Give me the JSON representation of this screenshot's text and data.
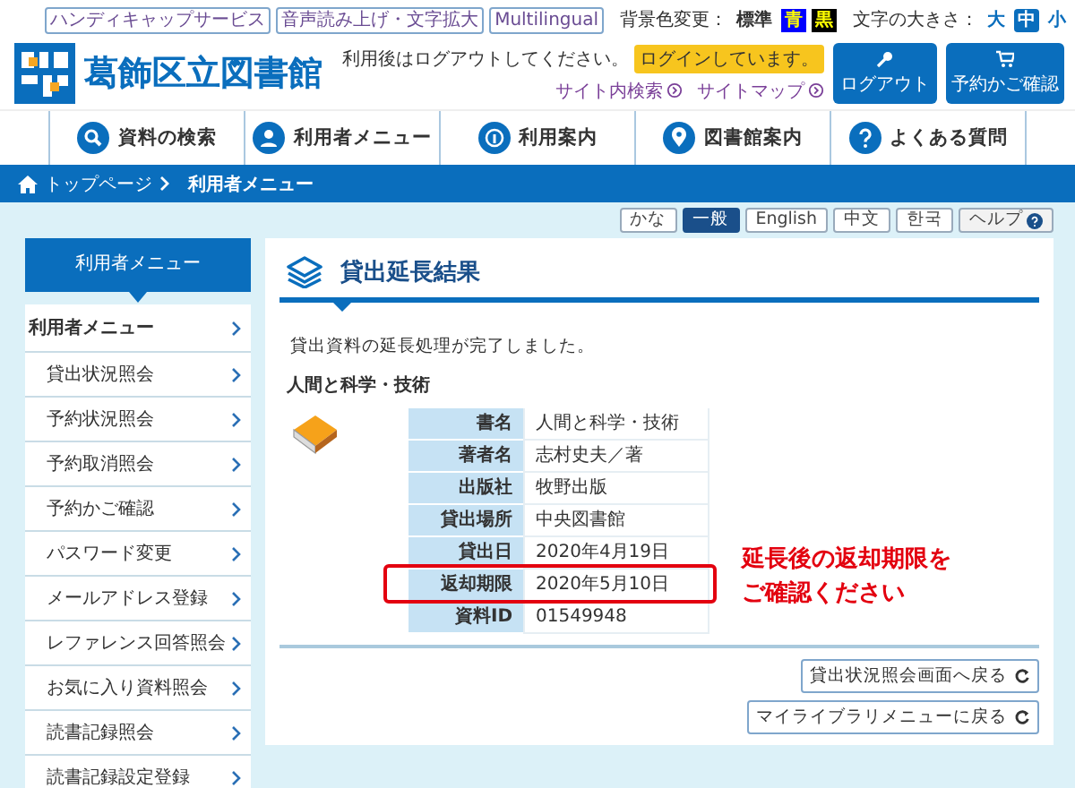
{
  "header": {
    "logo_title": "葛飾区立図書館",
    "links": [
      "ハンディキャップサービス",
      "音声読み上げ・文字拡大",
      "Multilingual"
    ],
    "bg_color": {
      "label": "背景色変更：",
      "options": [
        {
          "label": "標準",
          "color": "#ffffff"
        },
        {
          "label": "青",
          "color": "#0000ff"
        },
        {
          "label": "黒",
          "color": "#000000"
        }
      ]
    },
    "font_size": {
      "label": "文字の大きさ：",
      "options": [
        {
          "label": "大",
          "selected": false
        },
        {
          "label": "中",
          "selected": true
        },
        {
          "label": "小",
          "selected": false
        }
      ]
    },
    "logout_note": "利用後はログアウトしてください。",
    "login_status": "ログインしています。",
    "site_links": [
      "サイト内検索",
      "サイトマップ"
    ],
    "buttons": [
      {
        "label": "ログアウト",
        "kind": "key"
      },
      {
        "label": "予約かご確認",
        "kind": "cart"
      }
    ]
  },
  "nav": [
    {
      "label": "資料の検索",
      "kind": "search"
    },
    {
      "label": "利用者メニュー",
      "kind": "person"
    },
    {
      "label": "利用案内",
      "kind": "info"
    },
    {
      "label": "図書館案内",
      "kind": "pin"
    },
    {
      "label": "よくある質問",
      "kind": "question"
    }
  ],
  "breadcrumb": [
    "トップページ",
    "利用者メニュー"
  ],
  "languages": [
    {
      "label": "かな",
      "selected": false
    },
    {
      "label": "一般",
      "selected": true
    },
    {
      "label": "English",
      "selected": false
    },
    {
      "label": "中文",
      "selected": false
    },
    {
      "label": "한국",
      "selected": false
    }
  ],
  "help": "ヘルプ",
  "sidebar": {
    "title": "利用者メニュー",
    "items": [
      {
        "label": "利用者メニュー",
        "selected": true
      },
      {
        "label": "貸出状況照会",
        "selected": false
      },
      {
        "label": "予約状況照会",
        "selected": false
      },
      {
        "label": "予約取消照会",
        "selected": false
      },
      {
        "label": "予約かご確認",
        "selected": false
      },
      {
        "label": "パスワード変更",
        "selected": false
      },
      {
        "label": "メールアドレス登録",
        "selected": false
      },
      {
        "label": "レファレンス回答照会",
        "selected": false
      },
      {
        "label": "お気に入り資料照会",
        "selected": false
      },
      {
        "label": "読書記録照会",
        "selected": false
      },
      {
        "label": "読書記録設定登録",
        "selected": false
      }
    ]
  },
  "main": {
    "title": "貸出延長結果",
    "message": "貸出資料の延長処理が完了しました。",
    "book_title": "人間と科学・技術",
    "details": [
      {
        "label": "書名",
        "value": "人間と科学・技術",
        "highlighted": false
      },
      {
        "label": "著者名",
        "value": "志村史夫／著",
        "highlighted": false
      },
      {
        "label": "出版社",
        "value": "牧野出版",
        "highlighted": false
      },
      {
        "label": "貸出場所",
        "value": "中央図書館",
        "highlighted": false
      },
      {
        "label": "貸出日",
        "value": "2020年4月19日",
        "highlighted": false
      },
      {
        "label": "返却期限",
        "value": "2020年5月10日",
        "highlighted": true
      },
      {
        "label": "資料ID",
        "value": "01549948",
        "highlighted": false
      }
    ],
    "annotation": [
      "延長後の返却期限を",
      "ご確認ください"
    ],
    "buttons": [
      "貸出状況照会画面へ戻る",
      "マイライブラリメニューに戻る"
    ]
  }
}
